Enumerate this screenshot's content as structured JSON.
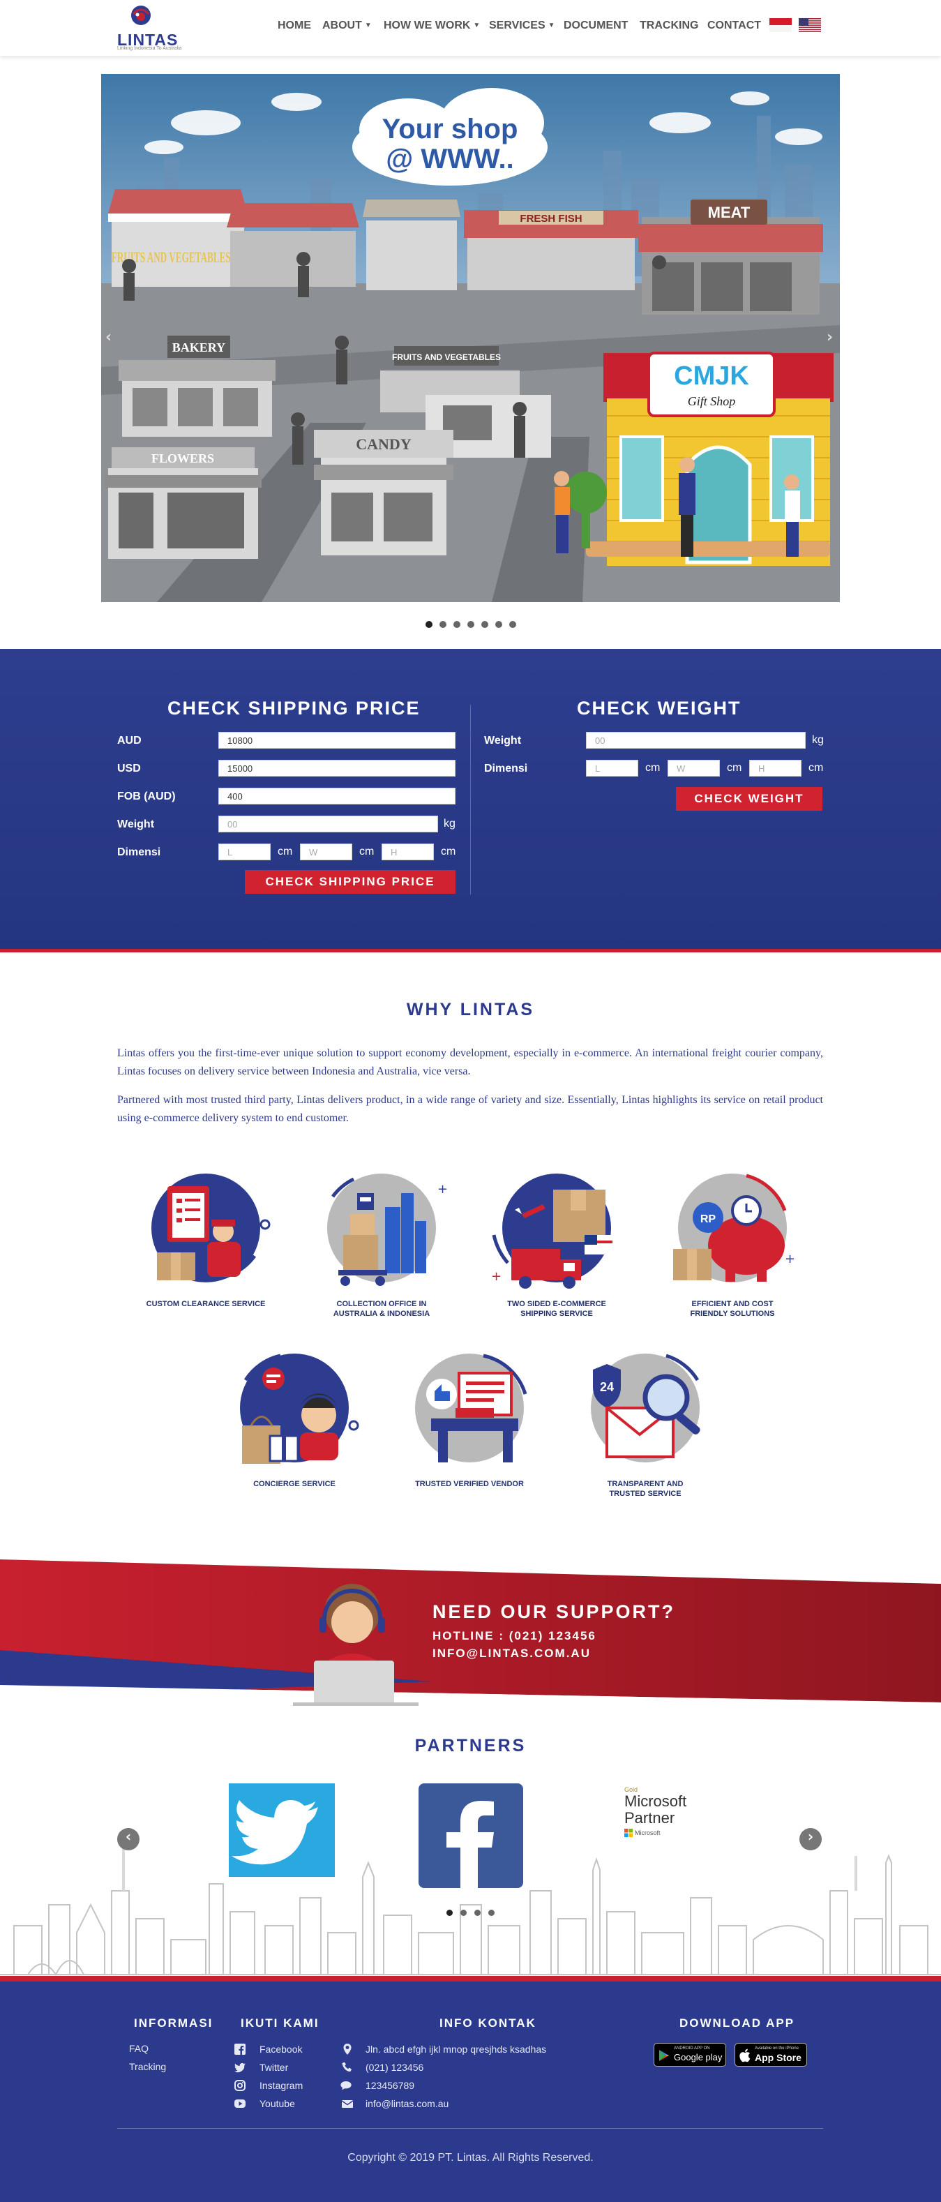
{
  "brand": {
    "name": "LINTAS",
    "tagline": "Linking Indonesia To Australia"
  },
  "nav": {
    "items": [
      {
        "label": "HOME",
        "dropdown": false
      },
      {
        "label": "ABOUT",
        "dropdown": true
      },
      {
        "label": "HOW WE WORK",
        "dropdown": true
      },
      {
        "label": "SERVICES",
        "dropdown": true
      },
      {
        "label": "DOCUMENT",
        "dropdown": false
      },
      {
        "label": "TRACKING",
        "dropdown": false
      },
      {
        "label": "CONTACT",
        "dropdown": false
      }
    ],
    "languages": [
      "indonesia-flag-icon",
      "us-flag-icon"
    ]
  },
  "hero": {
    "cloud_line1": "Your shop",
    "cloud_line2": "@ WWW..",
    "signs": {
      "fruits": "FRUITS AND VEGETABLES",
      "fresh_fish": "FRESH FISH",
      "meat": "MEAT",
      "bakery": "BAKERY",
      "fruits_veg": "FRUITS AND VEGETABLES",
      "flowers": "FLOWERS",
      "candy": "CANDY",
      "cmjk": "CMJK",
      "gift_shop": "Gift Shop"
    },
    "slide_count": 7,
    "active_slide": 1
  },
  "shipping": {
    "title": "CHECK SHIPPING PRICE",
    "fields": {
      "aud": {
        "label": "AUD",
        "value": "10800"
      },
      "usd": {
        "label": "USD",
        "value": "15000"
      },
      "fob": {
        "label": "FOB (AUD)",
        "value": "400"
      },
      "weight": {
        "label": "Weight",
        "placeholder": "00",
        "unit": "kg"
      },
      "dimensi": {
        "label": "Dimensi",
        "l": "L",
        "w": "W",
        "h": "H",
        "unit": "cm"
      }
    },
    "button": "CHECK SHIPPING PRICE"
  },
  "weight_check": {
    "title": "CHECK WEIGHT",
    "weight": {
      "label": "Weight",
      "placeholder": "00",
      "unit": "kg"
    },
    "dimensi": {
      "label": "Dimensi",
      "l": "L",
      "w": "W",
      "h": "H",
      "unit": "cm"
    },
    "button": "CHECK WEIGHT"
  },
  "why": {
    "title": "WHY LINTAS",
    "para1": "Lintas offers you the first-time-ever unique solution to support economy development, especially in e-commerce. An international freight courier company, Lintas focuses on delivery service between Indonesia and Australia, vice versa.",
    "para2": "Partnered with most trusted third party, Lintas delivers product, in a wide range of variety and size. Essentially, Lintas highlights its service on retail product using e-commerce delivery system to end customer.",
    "features": [
      {
        "line1": "CUSTOM CLEARANCE SERVICE",
        "line2": ""
      },
      {
        "line1": "COLLECTION OFFICE IN",
        "line2": "AUSTRALIA & INDONESIA"
      },
      {
        "line1": "TWO SIDED E-COMMERCE",
        "line2": "SHIPPING SERVICE"
      },
      {
        "line1": "EFFICIENT AND COST",
        "line2": "FRIENDLY SOLUTIONS"
      },
      {
        "line1": "CONCIERGE SERVICE",
        "line2": ""
      },
      {
        "line1": "TRUSTED VERIFIED VENDOR",
        "line2": ""
      },
      {
        "line1": "TRANSPARENT AND",
        "line2": "TRUSTED SERVICE"
      }
    ],
    "badges": {
      "rp": "RP",
      "h24": "24"
    }
  },
  "support": {
    "title": "NEED OUR SUPPORT?",
    "hotline": "HOTLINE : (021) 123456",
    "email": "INFO@LINTAS.COM.AU"
  },
  "partners": {
    "title": "PARTNERS",
    "microsoft": {
      "gold": "Gold",
      "line1": "Microsoft",
      "line2": "Partner",
      "small": "Microsoft"
    },
    "slide_count": 4,
    "active_slide": 1
  },
  "footer": {
    "informasi": {
      "title": "INFORMASI",
      "links": [
        "FAQ",
        "Tracking"
      ]
    },
    "ikuti": {
      "title": "IKUTI KAMI",
      "links": [
        {
          "label": "Facebook",
          "icon": "facebook-icon"
        },
        {
          "label": "Twitter",
          "icon": "twitter-icon"
        },
        {
          "label": "Instagram",
          "icon": "instagram-icon"
        },
        {
          "label": "Youtube",
          "icon": "youtube-icon"
        }
      ]
    },
    "kontak": {
      "title": "INFO KONTAK",
      "items": [
        {
          "label": "Jln. abcd efgh ijkl mnop qresjhds ksadhas",
          "icon": "location-pin-icon"
        },
        {
          "label": "(021) 123456",
          "icon": "phone-icon"
        },
        {
          "label": "123456789",
          "icon": "chat-icon"
        },
        {
          "label": "info@lintas.com.au",
          "icon": "mail-icon"
        }
      ]
    },
    "app": {
      "title": "DOWNLOAD APP",
      "google_small": "ANDROID APP ON",
      "google_big": "Google play",
      "apple_small": "Available on the iPhone",
      "apple_big": "App Store"
    },
    "copyright": "Copyright © 2019 PT. Lintas. All Rights Reserved."
  },
  "colors": {
    "navy": "#2b3a8c",
    "red": "#c8202e",
    "button_red": "#d1232f"
  }
}
